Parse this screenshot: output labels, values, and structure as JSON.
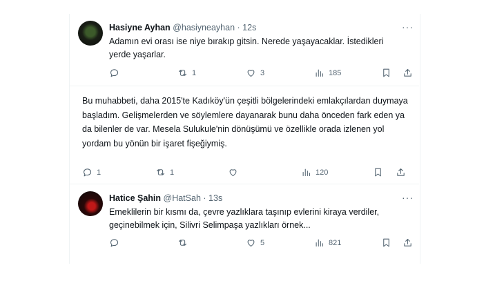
{
  "tweets": [
    {
      "name": "Hasiyne Ayhan",
      "handle": "@hasiyneayhan",
      "dot": "·",
      "time": "12s",
      "text": "Adamın evi orası ise niye bırakıp gitsin.  Nerede yaşayacaklar. İstedikleri yerde yaşarlar.",
      "replies": "",
      "retweets": "1",
      "likes": "3",
      "views": "185"
    },
    {
      "text": "Bu muhabbeti, daha 2015'te Kadıköy'ün çeşitli bölgelerindeki emlakçılardan duymaya başladım. Gelişmelerden ve söylemlere dayanarak bunu daha önceden fark eden ya da bilenler de var. Mesela Sulukule'nin dönüşümü ve özellikle orada izlenen yol yordam bu yönün bir işaret fişeğiymiş.",
      "replies": "1",
      "retweets": "1",
      "likes": "",
      "views": "120"
    },
    {
      "name": "Hatice Şahin",
      "handle": "@HatSah",
      "dot": "·",
      "time": "13s",
      "text": "Emeklilerin bir kısmı da, çevre yazlıklara taşınıp evlerini kiraya verdiler, geçinebilmek için, Silivri Selimpaşa yazlıkları örnek...",
      "replies": "",
      "retweets": "",
      "likes": "5",
      "views": "821"
    }
  ],
  "more_glyph": "···"
}
